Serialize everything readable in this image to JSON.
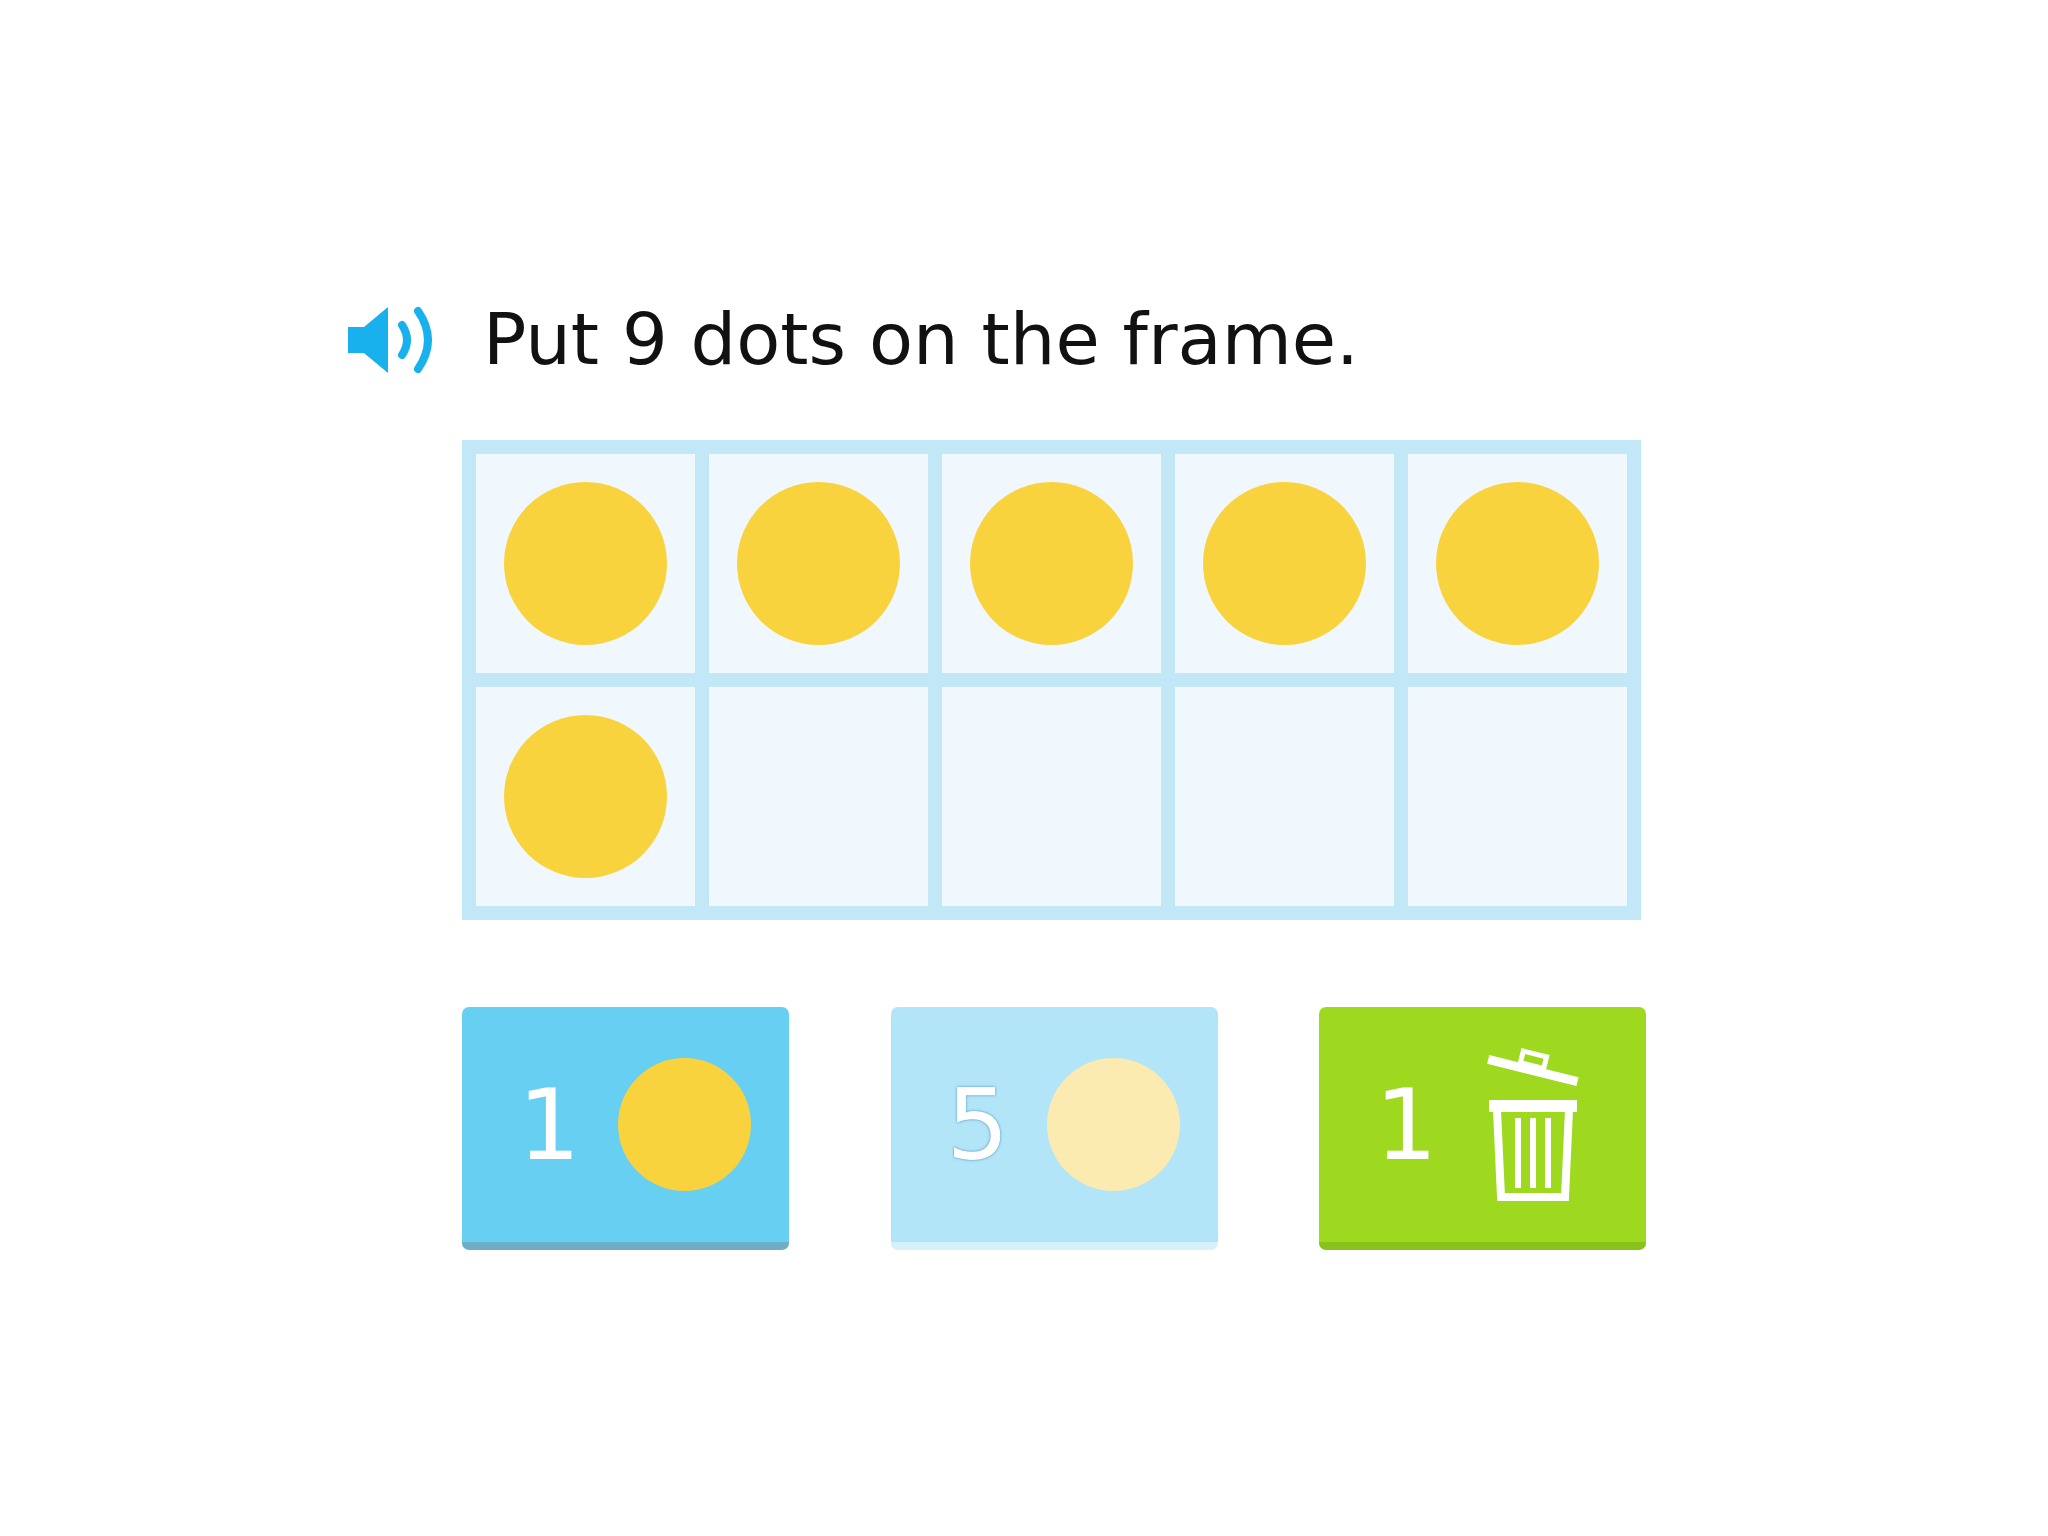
{
  "prompt": {
    "text": "Put 9 dots on the frame."
  },
  "ten_frame": {
    "cells": [
      {
        "filled": true
      },
      {
        "filled": true
      },
      {
        "filled": true
      },
      {
        "filled": true
      },
      {
        "filled": true
      },
      {
        "filled": true
      },
      {
        "filled": false
      },
      {
        "filled": false
      },
      {
        "filled": false
      },
      {
        "filled": false
      }
    ]
  },
  "buttons": [
    {
      "kind": "add",
      "label": "1",
      "disabled": false
    },
    {
      "kind": "add",
      "label": "5",
      "disabled": true
    },
    {
      "kind": "remove",
      "label": "1",
      "disabled": false
    }
  ]
}
